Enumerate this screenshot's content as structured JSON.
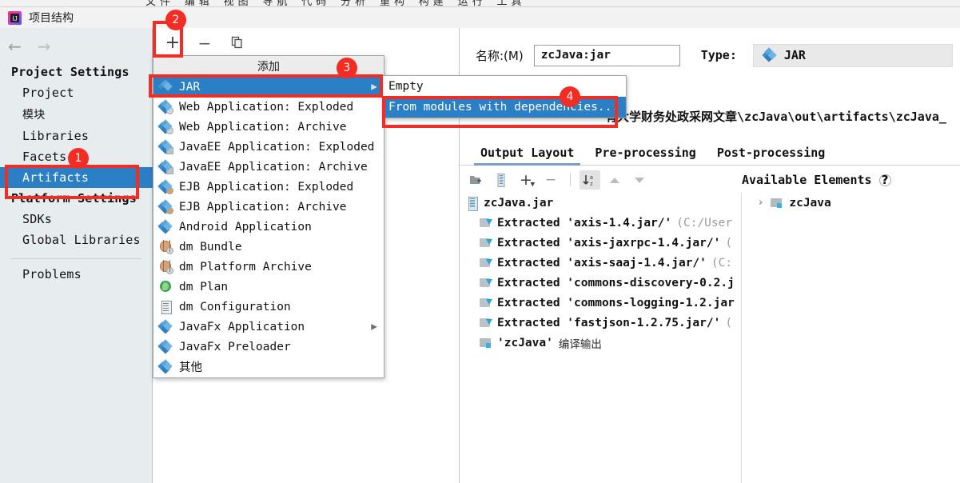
{
  "window": {
    "title": "项目结构",
    "app_icon": "intellij-idea-icon"
  },
  "top_strip": {
    "clipped_text": "文件 编辑 视图 导航 代码 分析 重构 构建 运行 工具"
  },
  "sidebar": {
    "back_icon": "arrow-left-icon",
    "forward_icon": "arrow-right-icon",
    "groups": [
      {
        "header": "Project Settings",
        "items": [
          {
            "label": "Project",
            "selected": false
          },
          {
            "label": "模块",
            "selected": false,
            "cjk": true
          },
          {
            "label": "Libraries",
            "selected": false
          },
          {
            "label": "Facets",
            "selected": false
          },
          {
            "label": "Artifacts",
            "selected": true
          }
        ]
      },
      {
        "header": "Platform Settings",
        "items": [
          {
            "label": "SDKs",
            "selected": false
          },
          {
            "label": "Global Libraries",
            "selected": false
          }
        ]
      }
    ],
    "problems": "Problems"
  },
  "add_toolbar": {
    "add_label": "+",
    "remove_label": "−",
    "copy_icon": "copy-icon"
  },
  "add_menu": {
    "title": "添加",
    "items": [
      {
        "label": "JAR",
        "icon": "artifact-jar-icon",
        "selected": true,
        "has_submenu": true
      },
      {
        "label": "Web Application: Exploded",
        "icon": "artifact-web-exploded-icon",
        "selected": false,
        "has_submenu": false
      },
      {
        "label": "Web Application: Archive",
        "icon": "artifact-web-archive-icon",
        "selected": false,
        "has_submenu": false
      },
      {
        "label": "JavaEE Application: Exploded",
        "icon": "artifact-javaee-exploded-icon",
        "selected": false,
        "has_submenu": false
      },
      {
        "label": "JavaEE Application: Archive",
        "icon": "artifact-javaee-archive-icon",
        "selected": false,
        "has_submenu": false
      },
      {
        "label": "EJB Application: Exploded",
        "icon": "artifact-ejb-exploded-icon",
        "selected": false,
        "has_submenu": false
      },
      {
        "label": "EJB Application: Archive",
        "icon": "artifact-ejb-archive-icon",
        "selected": false,
        "has_submenu": false
      },
      {
        "label": "Android Application",
        "icon": "artifact-android-icon",
        "selected": false,
        "has_submenu": false
      },
      {
        "label": "dm Bundle",
        "icon": "dm-bundle-icon",
        "selected": false,
        "has_submenu": false
      },
      {
        "label": "dm Platform Archive",
        "icon": "dm-platform-archive-icon",
        "selected": false,
        "has_submenu": false
      },
      {
        "label": "dm Plan",
        "icon": "dm-plan-icon",
        "selected": false,
        "has_submenu": false
      },
      {
        "label": "dm Configuration",
        "icon": "dm-configuration-icon",
        "selected": false,
        "has_submenu": false
      },
      {
        "label": "JavaFx Application",
        "icon": "artifact-javafx-app-icon",
        "selected": false,
        "has_submenu": true
      },
      {
        "label": "JavaFx Preloader",
        "icon": "artifact-javafx-preloader-icon",
        "selected": false,
        "has_submenu": false
      },
      {
        "label": "其他",
        "icon": "artifact-other-icon",
        "selected": false,
        "has_submenu": false,
        "cjk": true
      }
    ]
  },
  "jar_submenu": {
    "items": [
      {
        "label": "Empty",
        "selected": false
      },
      {
        "label": "From modules with dependencies...",
        "selected": true
      }
    ]
  },
  "detail": {
    "name_label": "名称:(M)",
    "name_value": "zcJava:jar",
    "type_label": "Type:",
    "type_value": "JAR",
    "type_icon": "artifact-jar-icon",
    "output_path_clipped": "有大学财务处政采网文章",
    "output_path_mono": "\\zcJava\\out\\artifacts\\zcJava_",
    "tabs": [
      {
        "label": "Output Layout",
        "active": true
      },
      {
        "label": "Pre-processing",
        "active": false
      },
      {
        "label": "Post-processing",
        "active": false
      }
    ],
    "layout_toolbar": [
      {
        "icon": "add-directory-icon"
      },
      {
        "icon": "add-archive-icon"
      },
      {
        "icon": "add-copy-icon"
      },
      {
        "icon": "remove-icon"
      },
      {
        "icon": "sort-alphabetically-icon"
      },
      {
        "icon": "move-up-icon"
      },
      {
        "icon": "move-down-icon"
      }
    ],
    "available_elements_label": "Available Elements",
    "help_icon": "question-mark-icon",
    "output_tree": [
      {
        "label": "zcJava.jar",
        "detail": "",
        "icon": "jar-icon",
        "indent": 0
      },
      {
        "label": "Extracted 'axis-1.4.jar/'",
        "detail": "(C:/User",
        "icon": "extracted-icon",
        "indent": 1
      },
      {
        "label": "Extracted 'axis-jaxrpc-1.4.jar/'",
        "detail": "(",
        "icon": "extracted-icon",
        "indent": 1
      },
      {
        "label": "Extracted 'axis-saaj-1.4.jar/'",
        "detail": "(C:",
        "icon": "extracted-icon",
        "indent": 1
      },
      {
        "label": "Extracted 'commons-discovery-0.2.j",
        "detail": "",
        "icon": "extracted-icon",
        "indent": 1
      },
      {
        "label": "Extracted 'commons-logging-1.2.jar",
        "detail": "",
        "icon": "extracted-icon",
        "indent": 1
      },
      {
        "label": "Extracted 'fastjson-1.2.75.jar/'",
        "detail": "(",
        "icon": "extracted-icon",
        "indent": 1
      },
      {
        "label": "'zcJava'",
        "detail_cjk": "编译输出",
        "icon": "module-output-icon",
        "indent": 1
      }
    ],
    "available_tree": [
      {
        "label": "zcJava",
        "icon": "module-folder-icon",
        "chevron": "›"
      }
    ]
  },
  "annotations": {
    "accent_color": "#f52c24",
    "badges": [
      {
        "number": "1",
        "target": "sidebar-item-artifacts"
      },
      {
        "number": "2",
        "target": "add-button"
      },
      {
        "number": "3",
        "target": "menu-item-jar"
      },
      {
        "number": "4",
        "target": "submenu-from-modules-with-dependencies"
      }
    ]
  }
}
